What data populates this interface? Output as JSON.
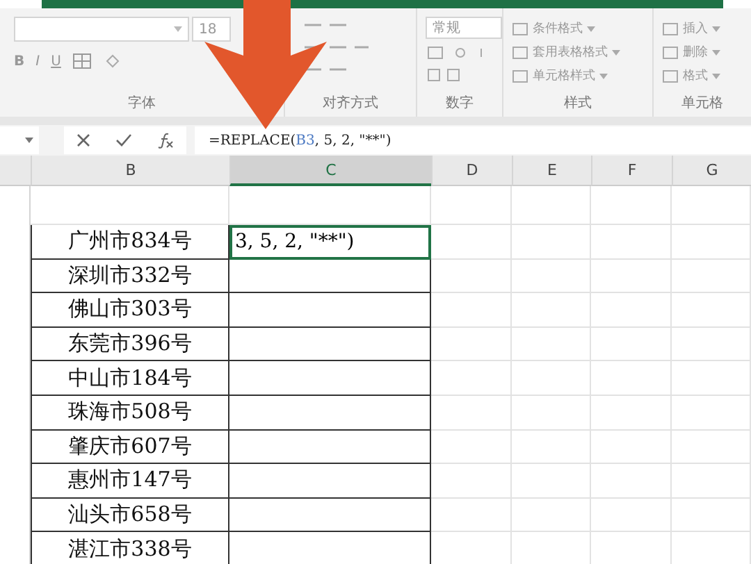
{
  "ribbon": {
    "font": {
      "font_size": "18",
      "format_buttons": [
        {
          "kind": "bold",
          "text": "B"
        },
        {
          "kind": "italic",
          "text": "I"
        },
        {
          "kind": "underline",
          "text": "U"
        }
      ],
      "label": "字体"
    },
    "alignment": {
      "label": "对齐方式"
    },
    "number": {
      "format": "常规",
      "label": "数字"
    },
    "styles": {
      "items": [
        "条件格式",
        "套用表格格式",
        "单元格样式"
      ],
      "label": "样式"
    },
    "cells": {
      "items": [
        "插入",
        "删除",
        "格式"
      ],
      "label": "单元格"
    }
  },
  "formula_bar": {
    "formula": [
      {
        "kind": "text",
        "text": "=REPLACE("
      },
      {
        "kind": "ref",
        "text": "B3"
      },
      {
        "kind": "text",
        "text": ", 5, 2, \"**\")"
      }
    ]
  },
  "columns": [
    {
      "label": "B",
      "selected": false
    },
    {
      "label": "C",
      "selected": true
    },
    {
      "label": "D",
      "selected": false
    },
    {
      "label": "E",
      "selected": false
    },
    {
      "label": "F",
      "selected": false
    },
    {
      "label": "G",
      "selected": false
    }
  ],
  "rows": [
    {
      "b": "广州市834号",
      "c": "3, 5, 2, \"**\")",
      "selected": true
    },
    {
      "b": "深圳市332号",
      "selected": false
    },
    {
      "b": "佛山市303号",
      "selected": false
    },
    {
      "b": "东莞市396号",
      "selected": false
    },
    {
      "b": "中山市184号",
      "selected": false
    },
    {
      "b": "珠海市508号",
      "selected": false
    },
    {
      "b": "肇庆市607号",
      "selected": false
    },
    {
      "b": "惠州市147号",
      "selected": false
    },
    {
      "b": "汕头市658号",
      "selected": false
    },
    {
      "b": "湛江市338号",
      "selected": false
    }
  ]
}
